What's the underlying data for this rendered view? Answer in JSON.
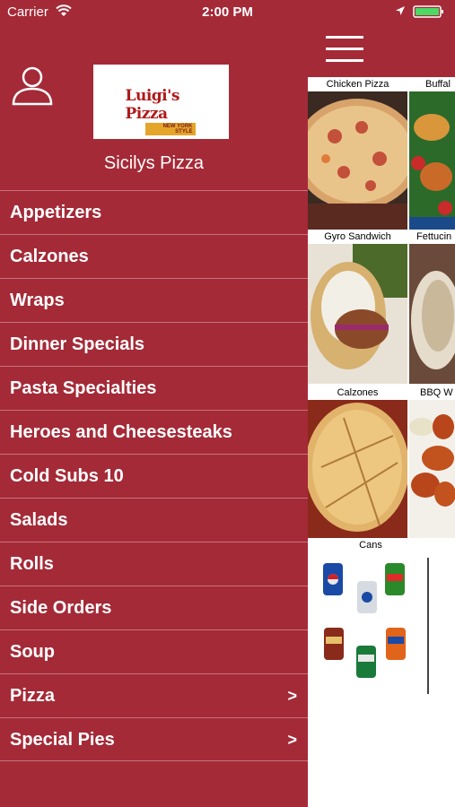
{
  "status_bar": {
    "carrier": "Carrier",
    "time": "2:00 PM"
  },
  "sidebar": {
    "logo": {
      "main": "Luigi's Pizza",
      "sub": "NEW YORK STYLE"
    },
    "store_name": "Sicilys Pizza",
    "items": [
      {
        "label": "Appetizers",
        "chevron": ""
      },
      {
        "label": "Calzones",
        "chevron": ""
      },
      {
        "label": "Wraps",
        "chevron": ""
      },
      {
        "label": "Dinner Specials",
        "chevron": ""
      },
      {
        "label": "Pasta Specialties",
        "chevron": ""
      },
      {
        "label": "Heroes and Cheesesteaks",
        "chevron": ""
      },
      {
        "label": "Cold Subs 10",
        "chevron": ""
      },
      {
        "label": "Salads",
        "chevron": ""
      },
      {
        "label": "Rolls",
        "chevron": ""
      },
      {
        "label": "Side Orders",
        "chevron": ""
      },
      {
        "label": "Soup",
        "chevron": ""
      },
      {
        "label": "Pizza",
        "chevron": ">"
      },
      {
        "label": "Special Pies",
        "chevron": ">"
      }
    ]
  },
  "content": {
    "tiles": [
      {
        "label": "Chicken Pizza"
      },
      {
        "label": "Buffal"
      },
      {
        "label": "Gyro Sandwich"
      },
      {
        "label": "Fettucin"
      },
      {
        "label": "Calzones"
      },
      {
        "label": "BBQ W"
      },
      {
        "label": "Cans"
      }
    ]
  },
  "colors": {
    "brand": "#a42a37",
    "divider": "#c8737c"
  }
}
